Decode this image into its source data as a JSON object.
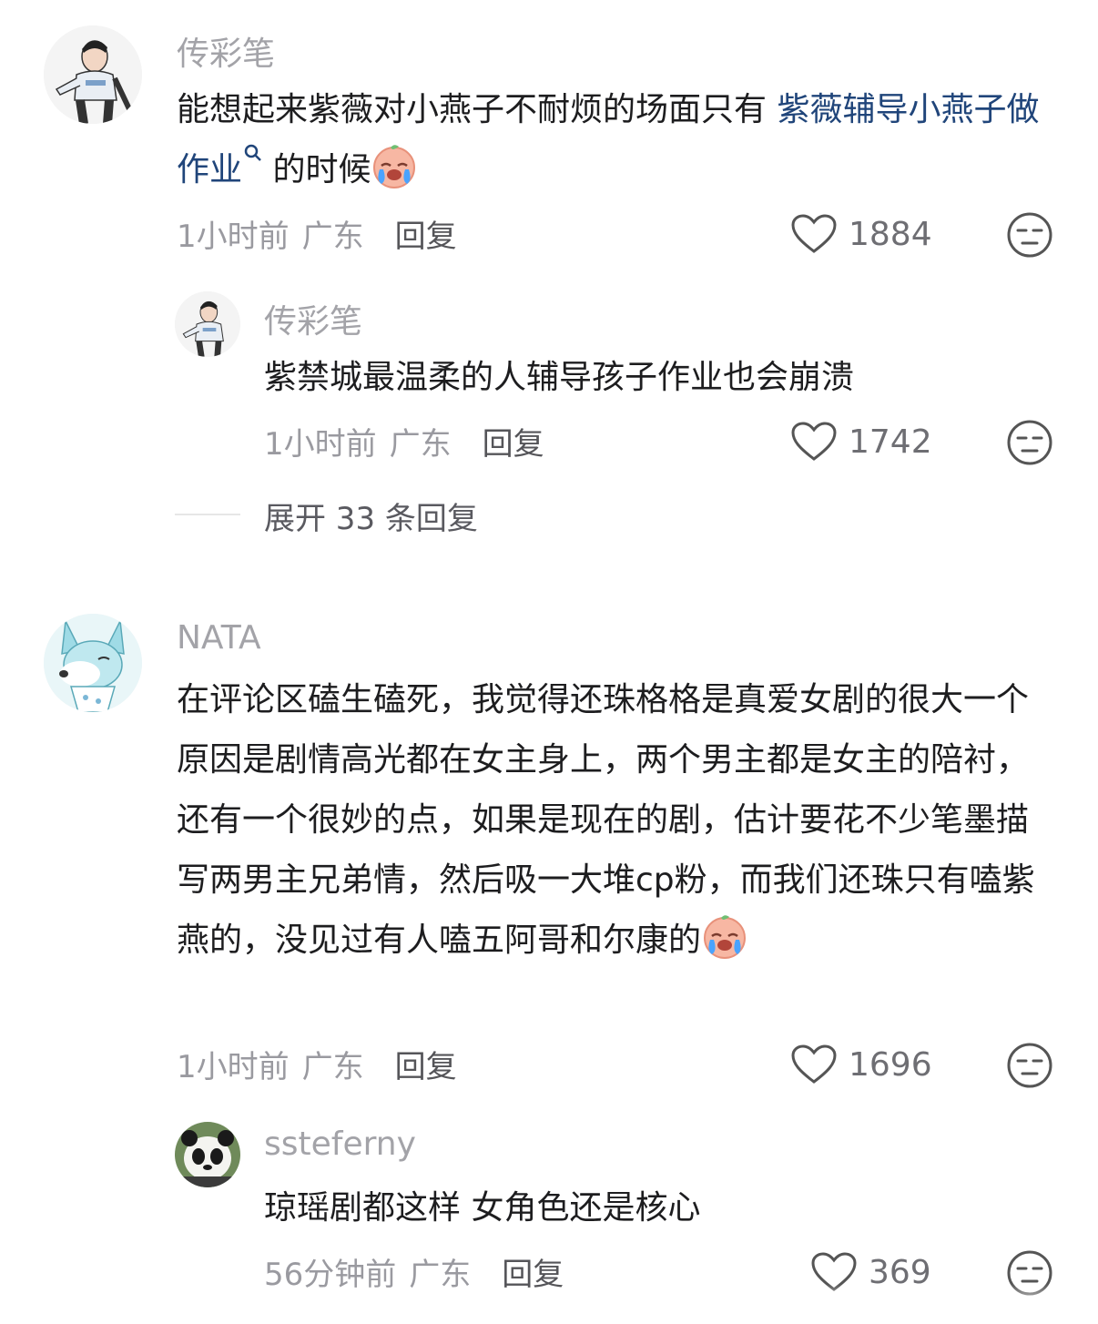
{
  "comments": [
    {
      "username": "传彩笔",
      "text_before": "能想起来紫薇对小燕子不耐烦的场面只有 ",
      "link_text": "紫薇辅导小燕子做作业",
      "text_after": " 的时候",
      "emoji": "crying-face-emoji",
      "time": "1小时前",
      "location": "广东",
      "reply_label": "回复",
      "likes": "1884"
    },
    {
      "username": "NATA",
      "text": "在评论区磕生磕死，我觉得还珠格格是真爱女剧的很大一个原因是剧情高光都在女主身上，两个男主都是女主的陪衬，还有一个很妙的点，如果是现在的剧，估计要花不少笔墨描写两男主兄弟情，然后吸一大堆cp粉，而我们还珠只有嗑紫燕的，没见过有人嗑五阿哥和尔康的",
      "emoji": "crying-face-emoji",
      "time": "1小时前",
      "location": "广东",
      "reply_label": "回复",
      "likes": "1696"
    }
  ],
  "replies": [
    {
      "username": "传彩笔",
      "text": "紫禁城最温柔的人辅导孩子作业也会崩溃",
      "time": "1小时前",
      "location": "广东",
      "reply_label": "回复",
      "likes": "1742"
    },
    {
      "username": "ssteferny",
      "text": "琼瑶剧都这样 女角色还是核心",
      "time": "56分钟前",
      "location": "广东",
      "reply_label": "回复",
      "likes": "369"
    }
  ],
  "expand_replies": "展开 33 条回复",
  "icons": {
    "like": "heart-outline-icon",
    "dislike": "unamused-face-icon",
    "search": "search-icon"
  },
  "colors": {
    "link": "#20457a",
    "username": "#a3a3a8",
    "meta": "#9a9aa0"
  }
}
